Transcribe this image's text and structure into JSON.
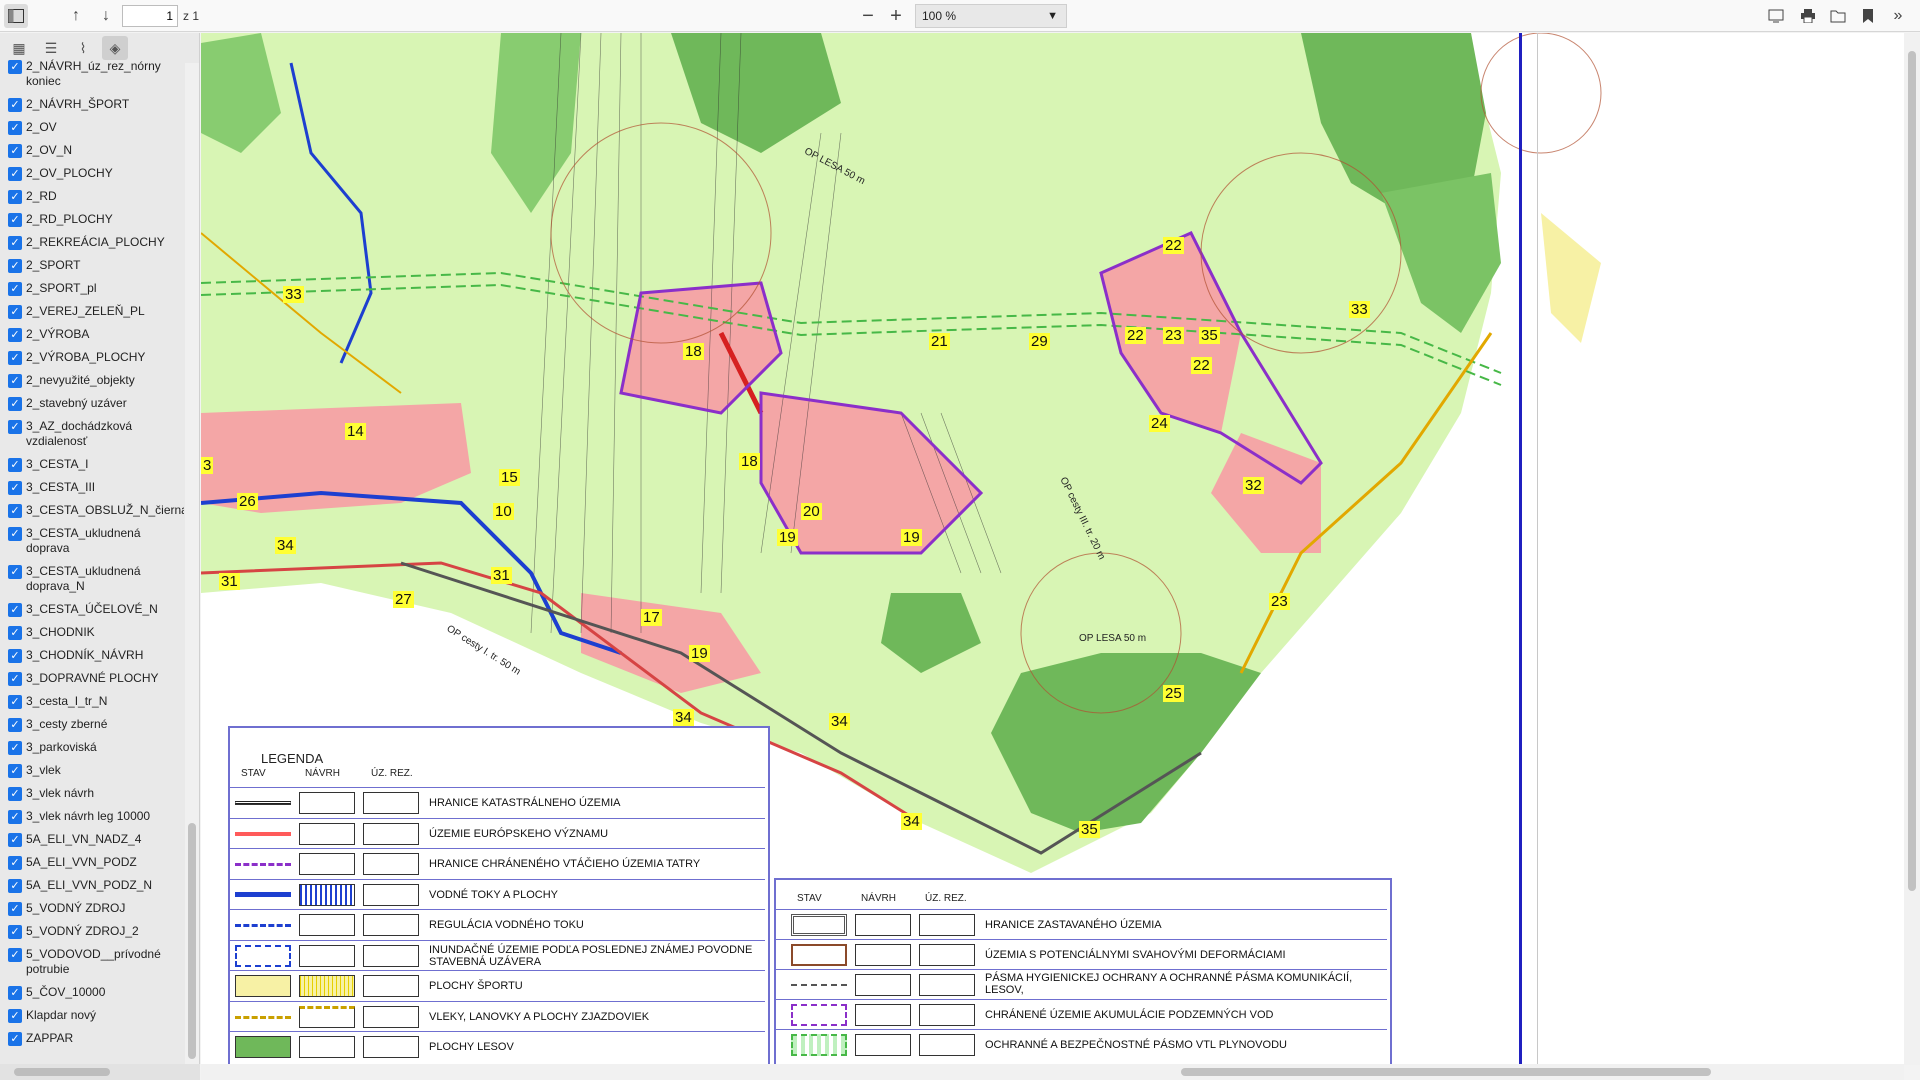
{
  "toolbar": {
    "page_current": "1",
    "page_total_label": "z 1",
    "zoom_label": "100 %",
    "zoom_out_label": "−",
    "zoom_in_label": "+"
  },
  "sidebar": {
    "layers": [
      "2_NÁVRH_úz_rez_nórny koniec",
      "2_NÁVRH_ŠPORT",
      "2_OV",
      "2_OV_N",
      "2_OV_PLOCHY",
      "2_RD",
      "2_RD_PLOCHY",
      "2_REKREÁCIA_PLOCHY",
      "2_SPORT",
      "2_SPORT_pl",
      "2_VEREJ_ZELEŇ_PL",
      "2_VÝROBA",
      "2_VÝROBA_PLOCHY",
      "2_nevyužité_objekty",
      "2_stavebný uzáver",
      "3_AZ_dochádzková vzdialenosť",
      "3_CESTA_I",
      "3_CESTA_III",
      "3_CESTA_OBSLUŽ_N_čierna",
      "3_CESTA_ukludnená doprava",
      "3_CESTA_ukludnená doprava_N",
      "3_CESTA_ÚČELOVÉ_N",
      "3_CHODNIK",
      "3_CHODNÍK_NÁVRH",
      "3_DOPRAVNÉ PLOCHY",
      "3_cesta_I_tr_N",
      "3_cesty zberné",
      "3_parkoviská",
      "3_vlek",
      "3_vlek návrh",
      "3_vlek návrh leg 10000",
      "5A_ELI_VN_NADZ_4",
      "5A_ELI_VVN_PODZ",
      "5A_ELI_VVN_PODZ_N",
      "5_VODNÝ ZDROJ",
      "5_VODNÝ ZDROJ_2",
      "5_VODOVOD__prívodné potrubie",
      "5_ČOV_10000",
      "Klapdar nový",
      "ZAPPAR"
    ]
  },
  "map": {
    "labels": [
      "33",
      "18",
      "18",
      "21",
      "29",
      "22",
      "22",
      "23",
      "35",
      "22",
      "24",
      "33",
      "32",
      "14",
      "15",
      "10",
      "3",
      "26",
      "34",
      "31",
      "31",
      "27",
      "20",
      "19",
      "19",
      "19",
      "17",
      "34",
      "34",
      "23",
      "25",
      "34",
      "35"
    ],
    "annotations": {
      "op_lesa_top": "OP LESA 50 m",
      "op_lesa_mid": "OP LESA 50 m",
      "op_cesty_i": "OP cesty I. tr. 50 m",
      "op_cesty_iii": "OP cesty III. tr. 20 m"
    }
  },
  "legend_left": {
    "title": "LEGENDA",
    "col_stav": "STAV",
    "col_navrh": "NÁVRH",
    "col_uz": "ÚZ. REZ.",
    "rows": [
      "HRANICE KATASTRÁLNEHO ÚZEMIA",
      "ÚZEMIE EURÓPSKEHO VÝZNAMU",
      "HRANICE CHRÁNENÉHO VTÁČIEHO ÚZEMIA TATRY",
      "VODNÉ TOKY A PLOCHY",
      "REGULÁCIA VODNÉHO  TOKU",
      "INUNDAČNÉ ÚZEMIE PODĽA POSLEDNEJ ZNÁMEJ POVODNE STAVEBNÁ UZÁVERA",
      "PLOCHY  ŠPORTU",
      "VLEKY, LANOVKY A PLOCHY ZJAZDOVIEK",
      "PLOCHY LESOV"
    ]
  },
  "legend_right": {
    "col_stav": "STAV",
    "col_navrh": "NÁVRH",
    "col_uz": "ÚZ. REZ.",
    "rows": [
      "HRANICE ZASTAVANÉHO ÚZEMIA",
      "ÚZEMIA S POTENCIÁLNYMI SVAHOVÝMI DEFORMÁCIAMI",
      "PÁSMA HYGIENICKEJ OCHRANY A OCHRANNÉ  PÁSMA KOMUNIKÁCIÍ, LESOV,",
      "CHRÁNENÉ ÚZEMIE AKUMULÁCIE PODZEMNÝCH VOD",
      "OCHRANNÉ A BEZPEČNOSTNÉ PÁSMO VTL PLYNOVODU"
    ]
  },
  "colors": {
    "accent": "#1a73e8",
    "map_base": "#d9f5b5",
    "forest": "#6fb85a",
    "built": "#f4a6a6",
    "border_line": "#5b2ca0"
  }
}
